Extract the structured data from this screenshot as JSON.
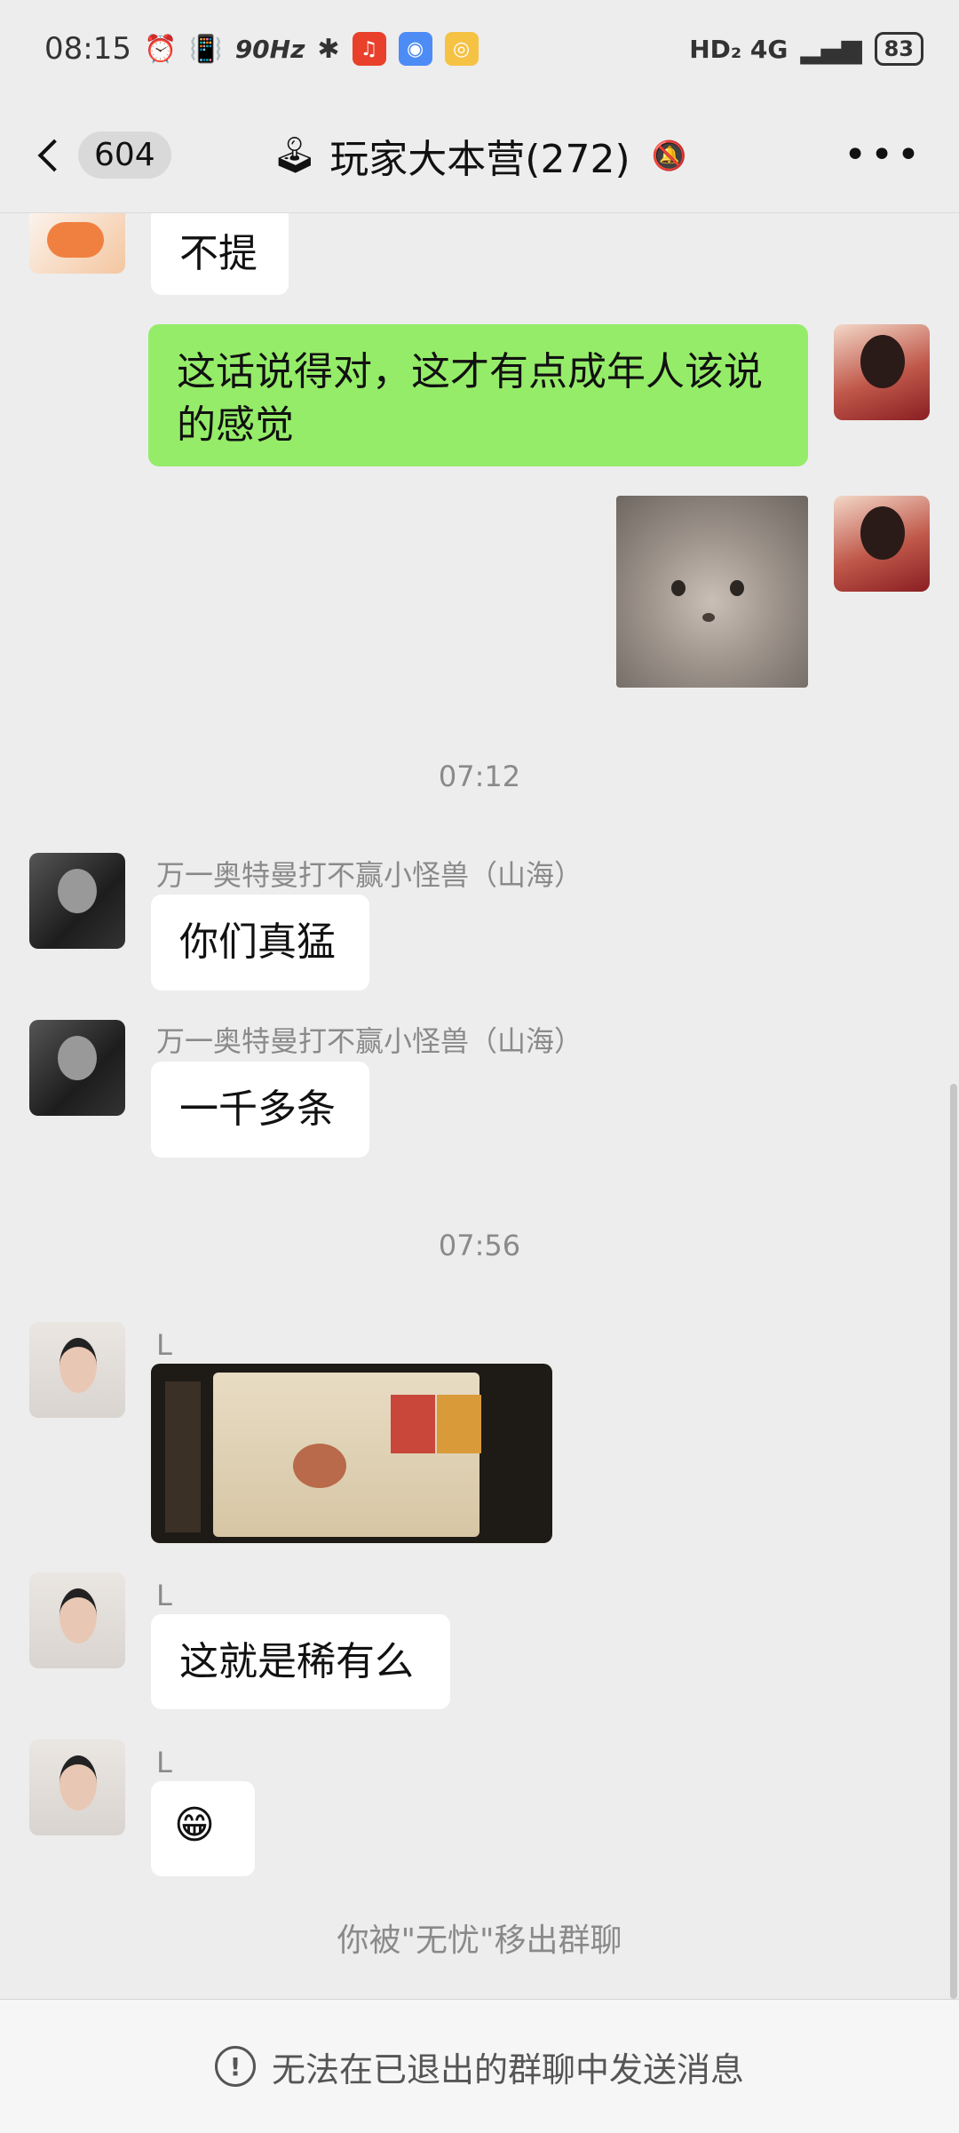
{
  "status_bar": {
    "time": "08:15",
    "refresh_rate": "90Hz",
    "network": "HD₂ 4G",
    "battery": "83"
  },
  "nav": {
    "unread_count": "604",
    "title": "玩家大本营(272)"
  },
  "messages": {
    "m1_text": "不提",
    "m2_text": "这话说得对，这才有点成年人该说的感觉",
    "ts1": "07:12",
    "m4_sender": "万一奥特曼打不赢小怪兽（山海）",
    "m4_text": "你们真猛",
    "m5_sender": "万一奥特曼打不赢小怪兽（山海）",
    "m5_text": "一千多条",
    "ts2": "07:56",
    "m6_sender": "L",
    "m7_sender": "L",
    "m7_text": "这就是稀有么",
    "m8_sender": "L",
    "m8_text": "😁",
    "system": "你被\"无忧\"移出群聊"
  },
  "bottom": {
    "notice": "无法在已退出的群聊中发送消息"
  },
  "colors": {
    "background": "#ededed",
    "sent_bubble": "#95ec69",
    "received_bubble": "#ffffff"
  }
}
